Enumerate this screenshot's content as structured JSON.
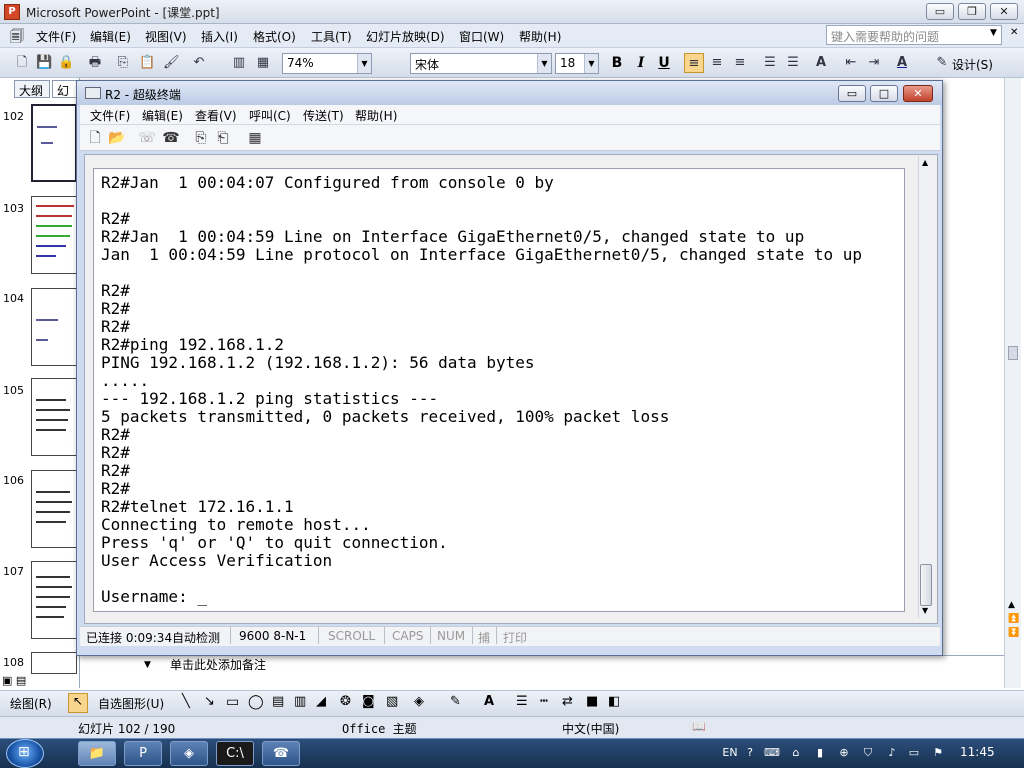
{
  "powerpoint": {
    "title": "Microsoft PowerPoint - [课堂.ppt]",
    "caption_buttons": [
      "▭",
      "❐",
      "✕"
    ],
    "menu": [
      "文件(F)",
      "编辑(E)",
      "视图(V)",
      "插入(I)",
      "格式(O)",
      "工具(T)",
      "幻灯片放映(D)",
      "窗口(W)",
      "帮助(H)"
    ],
    "help_placeholder": "键入需要帮助的问题",
    "zoom": "74%",
    "font_name": "宋体",
    "font_size": "18",
    "bold": "B",
    "italic": "I",
    "underline": "U",
    "design_button": "设计(S)",
    "pane_tabs": [
      "大纲",
      "幻"
    ],
    "slide_numbers": [
      "102",
      "103",
      "104",
      "105",
      "106",
      "107",
      "108"
    ],
    "notes_placeholder": "单击此处添加备注",
    "draw_menu": "绘图(R)",
    "autoshapes_menu": "自选图形(U)",
    "status": {
      "slide": "幻灯片 102 / 190",
      "theme": "Office 主题",
      "language": "中文(中国)"
    }
  },
  "hyperterminal": {
    "title": "R2 - 超级终端",
    "menu": [
      "文件(F)",
      "编辑(E)",
      "查看(V)",
      "呼叫(C)",
      "传送(T)",
      "帮助(H)"
    ],
    "terminal_lines": [
      "R2#Jan  1 00:04:07 Configured from console 0 by",
      "",
      "R2#",
      "R2#Jan  1 00:04:59 Line on Interface GigaEthernet0/5, changed state to up",
      "Jan  1 00:04:59 Line protocol on Interface GigaEthernet0/5, changed state to up",
      "",
      "R2#",
      "R2#",
      "R2#",
      "R2#ping 192.168.1.2",
      "PING 192.168.1.2 (192.168.1.2): 56 data bytes",
      ".....",
      "--- 192.168.1.2 ping statistics ---",
      "5 packets transmitted, 0 packets received, 100% packet loss",
      "R2#",
      "R2#",
      "R2#",
      "R2#",
      "R2#telnet 172.16.1.1",
      "Connecting to remote host...",
      "Press 'q' or 'Q' to quit connection.",
      "User Access Verification",
      "",
      "Username: _"
    ],
    "status": {
      "connected": "已连接 0:09:34",
      "detect": "自动检测",
      "baud": "9600 8-N-1",
      "scroll": "SCROLL",
      "caps": "CAPS",
      "num": "NUM",
      "capture": "捕",
      "print": "打印"
    }
  },
  "taskbar": {
    "lang": "EN",
    "time": "11:45"
  }
}
